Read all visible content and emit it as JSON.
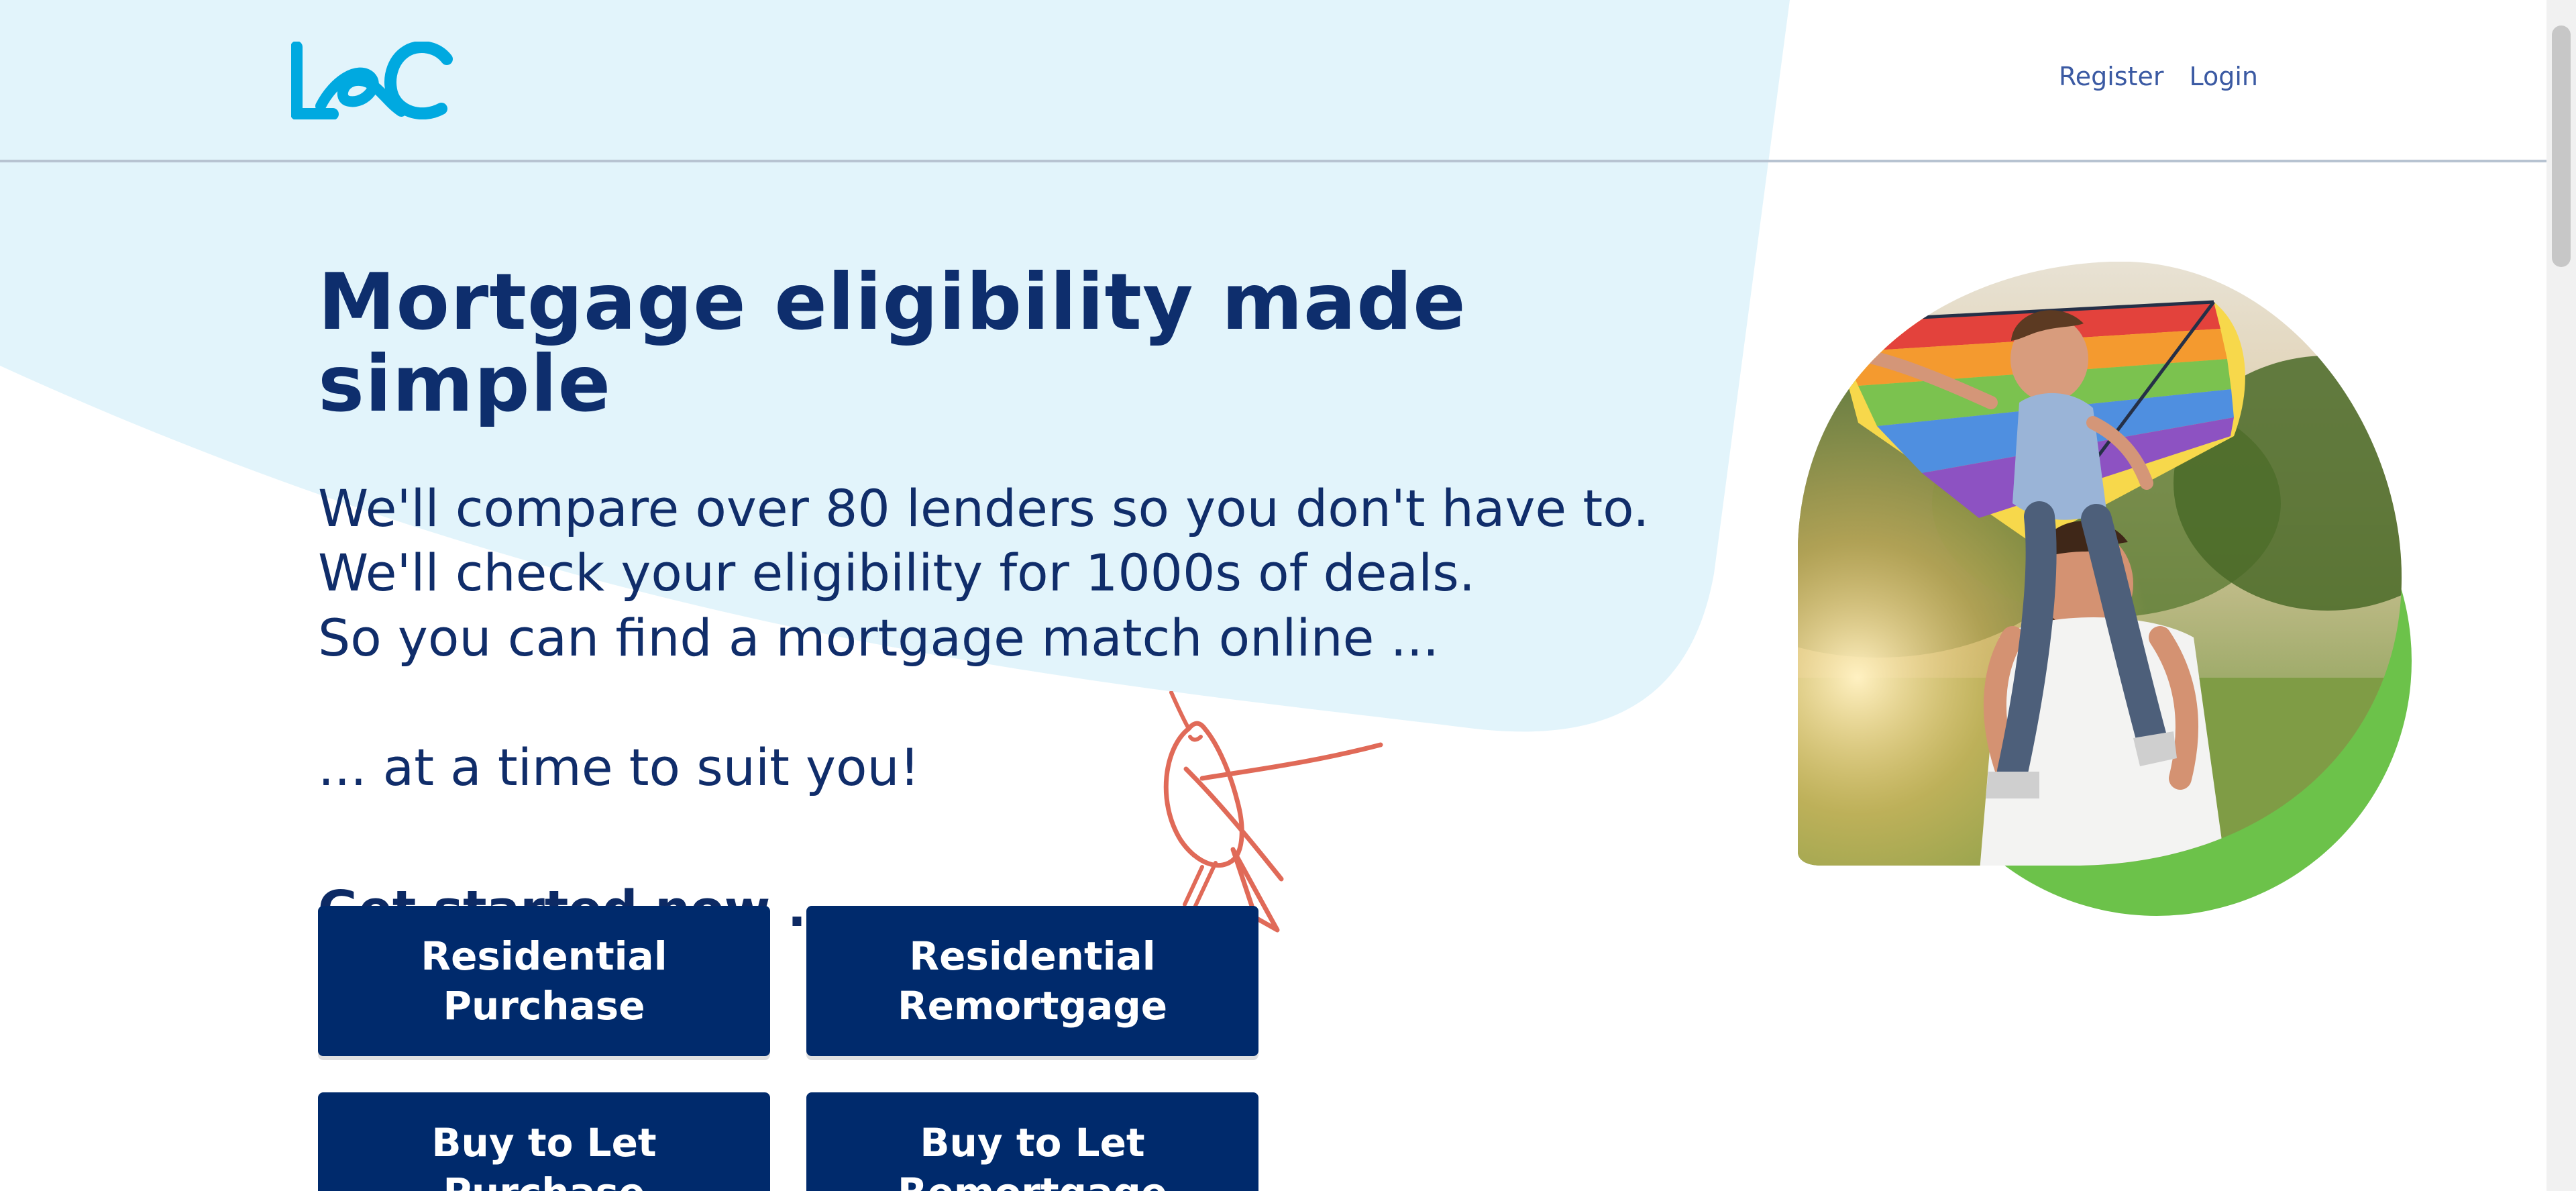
{
  "header": {
    "logo_alt": "L&C",
    "nav": {
      "register": "Register",
      "login": "Login"
    }
  },
  "hero": {
    "title": "Mortgage eligibility made simple",
    "lines": [
      "We'll compare over 80 lenders so you don't have to.",
      "We'll check your eligibility for 1000s of deals.",
      "So you can find a mortgage match online ..."
    ],
    "tail": "... at a time to suit you!",
    "cta_heading": "Get started now ...."
  },
  "buttons": [
    {
      "line1": "Residential",
      "line2": "Purchase"
    },
    {
      "line1": "Residential",
      "line2": "Remortgage"
    },
    {
      "line1": "Buy to Let",
      "line2": "Purchase"
    },
    {
      "line1": "Buy to Let",
      "line2": "Remortgage"
    }
  ],
  "colors": {
    "brand_blue": "#0e2e6d",
    "button_blue": "#002a6c",
    "light_blue": "#e2f4fb",
    "logo_blue": "#00a9e0",
    "green": "#6cc24a",
    "bird_red": "#e06a58"
  }
}
